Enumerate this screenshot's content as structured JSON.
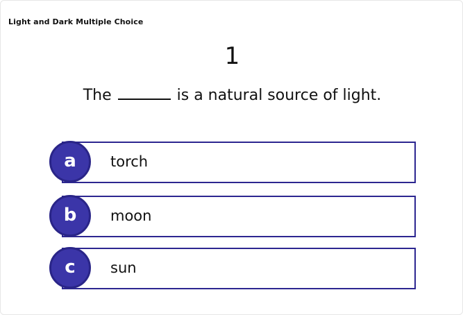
{
  "header": {
    "title": "Light and Dark Multiple Choice"
  },
  "question": {
    "number": "1",
    "text_before": "The",
    "text_after": "is a natural source of light."
  },
  "options": [
    {
      "letter": "a",
      "label": "torch"
    },
    {
      "letter": "b",
      "label": "moon"
    },
    {
      "letter": "c",
      "label": "sun"
    }
  ],
  "colors": {
    "accent": "#3b35a8",
    "border": "#2c2690",
    "text": "#111111",
    "background": "#ffffff"
  }
}
